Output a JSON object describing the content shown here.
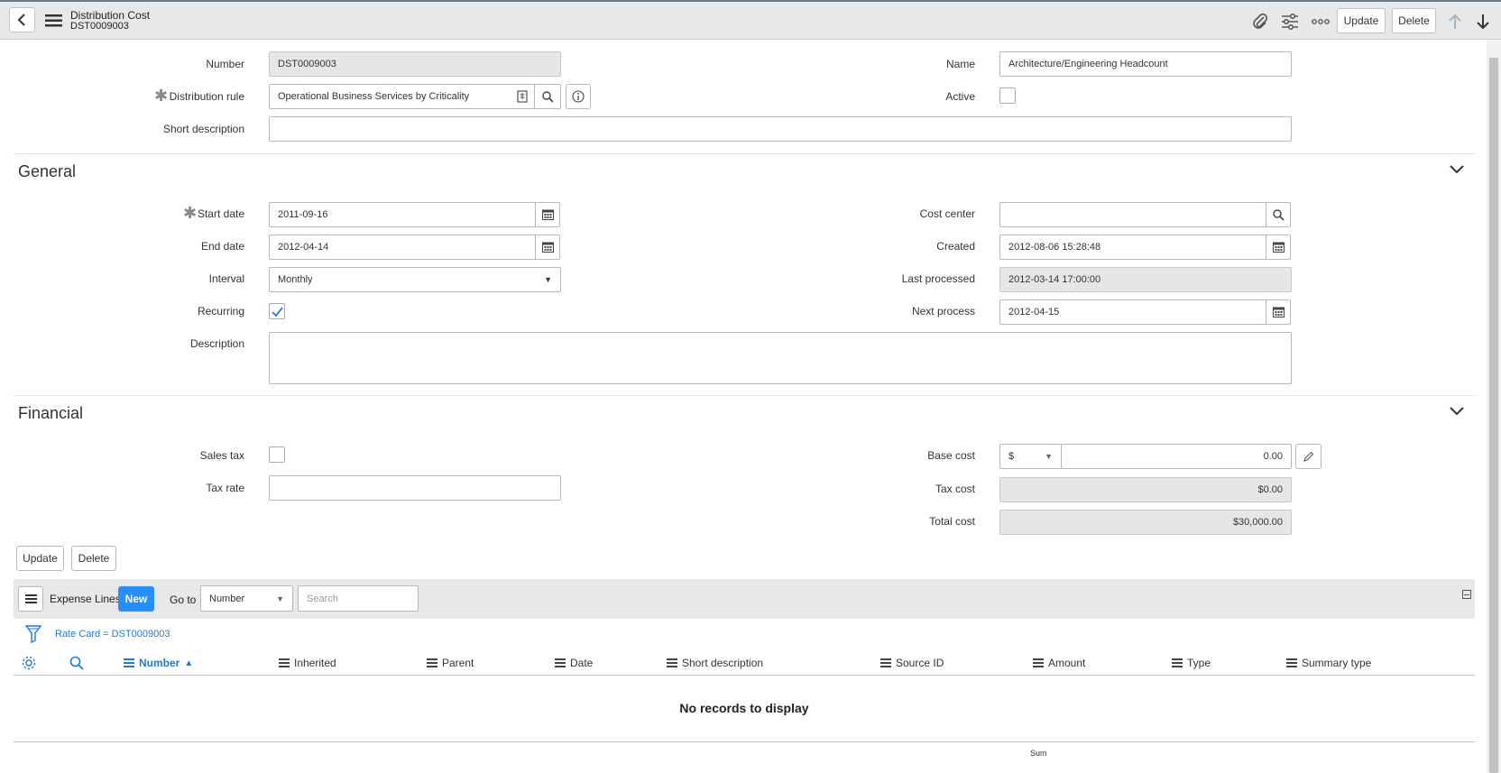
{
  "header": {
    "title": "Distribution Cost",
    "subtitle": "DST0009003",
    "update_label": "Update",
    "delete_label": "Delete"
  },
  "form": {
    "number": {
      "label": "Number",
      "value": "DST0009003"
    },
    "name": {
      "label": "Name",
      "value": "Architecture/Engineering Headcount"
    },
    "distribution_rule": {
      "label": "Distribution rule",
      "value": "Operational Business Services by Criticality"
    },
    "active": {
      "label": "Active",
      "checked": false
    },
    "short_description": {
      "label": "Short description",
      "value": ""
    }
  },
  "general": {
    "title": "General",
    "start_date": {
      "label": "Start date",
      "value": "2011-09-16"
    },
    "end_date": {
      "label": "End date",
      "value": "2012-04-14"
    },
    "interval": {
      "label": "Interval",
      "value": "Monthly"
    },
    "recurring": {
      "label": "Recurring",
      "checked": true
    },
    "description": {
      "label": "Description",
      "value": ""
    },
    "cost_center": {
      "label": "Cost center",
      "value": ""
    },
    "created": {
      "label": "Created",
      "value": "2012-08-06 15:28:48"
    },
    "last_processed": {
      "label": "Last processed",
      "value": "2012-03-14 17:00:00"
    },
    "next_process": {
      "label": "Next process",
      "value": "2012-04-15"
    }
  },
  "financial": {
    "title": "Financial",
    "sales_tax": {
      "label": "Sales tax",
      "checked": false
    },
    "tax_rate": {
      "label": "Tax rate",
      "value": ""
    },
    "base_cost": {
      "label": "Base cost",
      "currency": "$",
      "value": "0.00"
    },
    "tax_cost": {
      "label": "Tax cost",
      "value": "$0.00"
    },
    "total_cost": {
      "label": "Total cost",
      "value": "$30,000.00"
    }
  },
  "actions": {
    "update_label": "Update",
    "delete_label": "Delete"
  },
  "related_list": {
    "title": "Expense Lines",
    "new_label": "New",
    "goto_label": "Go to",
    "goto_field": "Number",
    "search_placeholder": "Search",
    "filter_text": "Rate Card = DST0009003",
    "columns": [
      "Number",
      "Inherited",
      "Parent",
      "Date",
      "Short description",
      "Source ID",
      "Amount",
      "Type",
      "Summary type"
    ],
    "sorted_column": "Number",
    "empty_text": "No records to display",
    "sum_label": "Sum"
  },
  "colors": {
    "accent": "#278efc",
    "link": "#1f7ad6",
    "header_bg": "#e6e8ea"
  },
  "icons": [
    "back-arrow-icon",
    "hamburger-icon",
    "paperclip-icon",
    "sliders-icon",
    "more-icon",
    "arrow-up-icon",
    "arrow-down-icon",
    "reference-icon",
    "search-icon",
    "info-icon",
    "calendar-icon",
    "check-icon",
    "chevron-down-icon",
    "pencil-icon",
    "filter-icon",
    "gear-icon",
    "collapse-icon",
    "sort-asc-icon"
  ]
}
